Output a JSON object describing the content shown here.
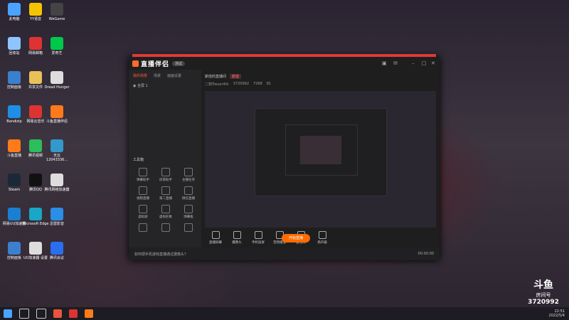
{
  "desktop_icons": [
    {
      "label": "此电脑",
      "icon": "computer-icon",
      "color": "#4aa3ff"
    },
    {
      "label": "YY语音",
      "icon": "yy-icon",
      "color": "#f5c400"
    },
    {
      "label": "WeGame",
      "icon": "wegame-icon",
      "color": "#444"
    },
    {
      "label": "回收站",
      "icon": "recycle-bin-icon",
      "color": "#8fc4ff"
    },
    {
      "label": "网易邮箱",
      "icon": "mail-icon",
      "color": "#d33"
    },
    {
      "label": "爱奇艺",
      "icon": "iqiyi-icon",
      "color": "#00c84a"
    },
    {
      "label": "控制面板",
      "icon": "control-panel-icon",
      "color": "#3b7fcf"
    },
    {
      "label": "共享文件",
      "icon": "folder-icon",
      "color": "#e8c15a"
    },
    {
      "label": "Dread Hunger",
      "icon": "file-icon",
      "color": "#ddd"
    },
    {
      "label": "Bandizip",
      "icon": "bandizip-icon",
      "color": "#1e8ee6"
    },
    {
      "label": "网易云音乐",
      "icon": "music-icon",
      "color": "#d33"
    },
    {
      "label": "斗鱼直播伴侣",
      "icon": "douyu-companion-icon",
      "color": "#ff7a1a"
    },
    {
      "label": "斗鱼直播",
      "icon": "douyu-icon",
      "color": "#ff7a1a"
    },
    {
      "label": "腾讯视频",
      "icon": "video-icon",
      "color": "#2dbd5a"
    },
    {
      "label": "天云 12043336...",
      "icon": "cloud-icon",
      "color": "#39c"
    },
    {
      "label": "Steam",
      "icon": "steam-icon",
      "color": "#1b2838"
    },
    {
      "label": "腾讯QQ",
      "icon": "qq-icon",
      "color": "#111"
    },
    {
      "label": "腾讯网络加速器",
      "icon": "file-icon",
      "color": "#ddd"
    },
    {
      "label": "网易UU加速器",
      "icon": "uu-icon",
      "color": "#1a7fd1"
    },
    {
      "label": "Microsoft Edge",
      "icon": "edge-icon",
      "color": "#1aa6c6"
    },
    {
      "label": "迅雷影音",
      "icon": "xunlei-icon",
      "color": "#2b8ee6"
    },
    {
      "label": "控制面板",
      "icon": "control-panel-icon",
      "color": "#3b7fcf"
    },
    {
      "label": "UU加速器 设置",
      "icon": "file-icon",
      "color": "#ddd"
    },
    {
      "label": "腾讯会议",
      "icon": "meeting-icon",
      "color": "#2a6ff0"
    }
  ],
  "app": {
    "title": "直播伴侣",
    "version": "测试",
    "tabs": [
      "我的场景",
      "场景",
      "画面设置"
    ],
    "scene": "全屏 1",
    "tools_title": "工具箱",
    "tools": [
      "弹幕助手",
      "房管助手",
      "主播任务",
      "视频直播",
      "第二直播",
      "微信直播",
      "虚拟屏",
      "虚拟形象",
      "弹幕板",
      "",
      "",
      ""
    ],
    "room_title": "斯佳的直播间",
    "room_tag": "颜值",
    "room_id": "3720992",
    "room_extra": "二狗Trevor4th",
    "stats": [
      "7268",
      "81"
    ],
    "bottom_tools": [
      "直播屏幕",
      "摄像头",
      "手机投屏",
      "音频播放",
      "麦克风",
      "扬声器"
    ],
    "live_button": "开始直播",
    "footer_hint": "如何把手机游戏直播通过摄像头？",
    "time": "00:00:00"
  },
  "douyu": {
    "logo": "斗鱼",
    "label": "房间号",
    "room": "3720992"
  },
  "taskbar": {
    "icons": [
      "windows-icon",
      "search-icon",
      "task-view-icon",
      "chrome-icon",
      "netease-icon",
      "douyu-icon"
    ],
    "time": "22:51",
    "date": "2022/5/4"
  }
}
